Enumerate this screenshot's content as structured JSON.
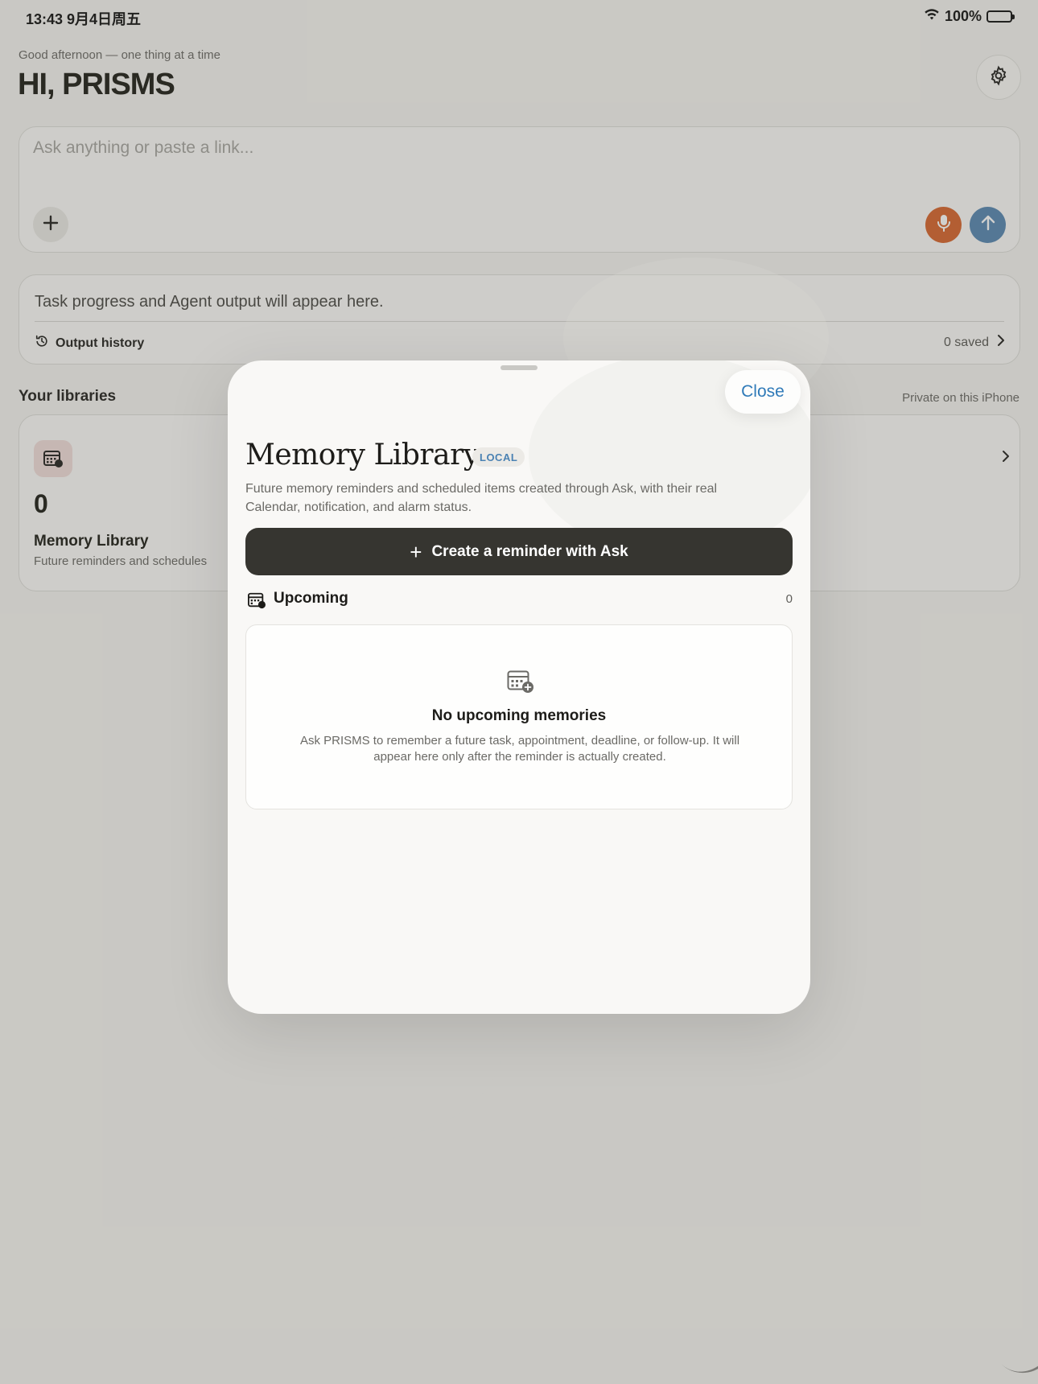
{
  "status_bar": {
    "time": "13:43  9月4日周五",
    "battery": "100%"
  },
  "header": {
    "greeting": "Good afternoon — one thing at a time",
    "title": "HI, PRISMS"
  },
  "ask": {
    "placeholder": "Ask anything or paste a link..."
  },
  "output": {
    "text": "Task progress and Agent output will appear here.",
    "history_label": "Output history",
    "saved_label": "0 saved"
  },
  "libraries": {
    "title": "Your libraries",
    "note": "Private on this iPhone",
    "items": [
      {
        "count": "0",
        "name": "Memory Library",
        "desc": "Future reminders and schedules"
      }
    ]
  },
  "sheet": {
    "close_label": "Close",
    "title": "Memory Library",
    "badge": "LOCAL",
    "description": "Future memory reminders and scheduled items created through Ask, with their real Calendar, notification, and alarm status.",
    "create_label": "Create a reminder with Ask",
    "create_plus": "+",
    "upcoming_label": "Upcoming",
    "upcoming_count": "0",
    "empty_title": "No upcoming memories",
    "empty_desc": "Ask PRISMS to remember a future task, appointment, deadline, or follow-up. It will appear here only after the reminder is actually created."
  },
  "colors": {
    "accent_blue": "#2f7ab8",
    "mic_orange": "#d96a34",
    "send_blue": "#5d8bb5",
    "primary_button": "#363530"
  },
  "icons": [
    "wifi-icon",
    "battery-icon",
    "gear-icon",
    "plus-icon",
    "mic-icon",
    "arrow-up-icon",
    "history-icon",
    "chevron-right-icon",
    "calendar-clock-icon",
    "calendar-add-icon"
  ]
}
